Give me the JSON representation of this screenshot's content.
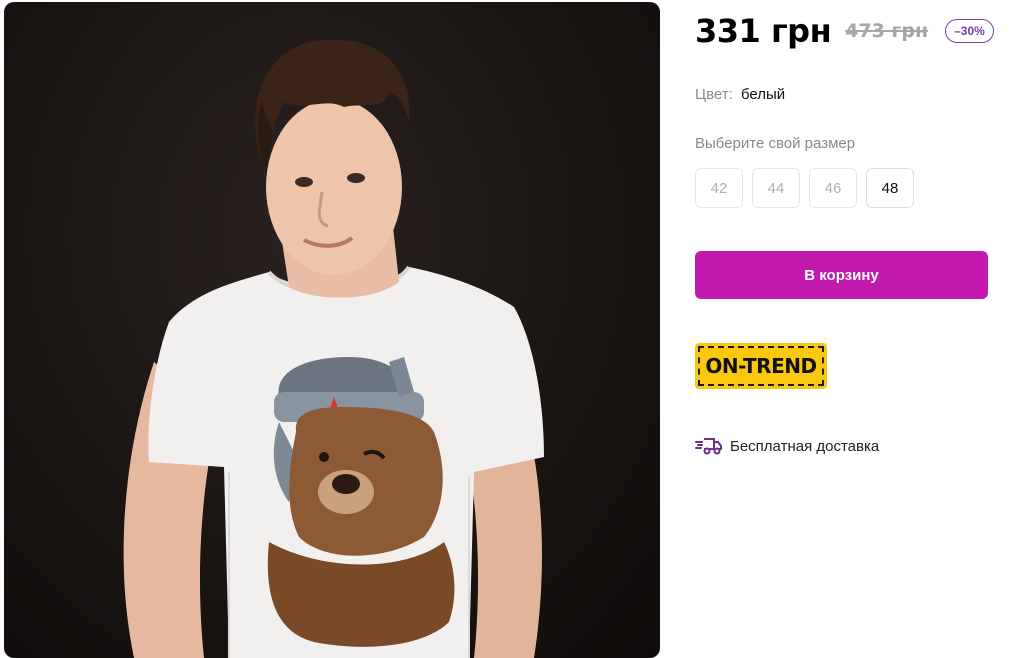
{
  "product": {
    "price_current": "331 грн",
    "price_old": "473 грн",
    "discount": "–30%",
    "color_label": "Цвет:",
    "color_value": "белый",
    "size_prompt": "Выберите свой размер",
    "sizes": [
      {
        "label": "42",
        "available": false
      },
      {
        "label": "44",
        "available": false
      },
      {
        "label": "46",
        "available": false
      },
      {
        "label": "48",
        "available": true
      }
    ],
    "add_to_cart_label": "В корзину",
    "badge_text": "ON-TREND",
    "delivery_text": "Бесплатная доставка",
    "delivery_icon": "delivery-truck-icon"
  },
  "colors": {
    "accent": "#c21aae",
    "discount": "#7b3fa6",
    "badge_bg": "#f8c90f",
    "old_price": "#a6a6a6"
  }
}
